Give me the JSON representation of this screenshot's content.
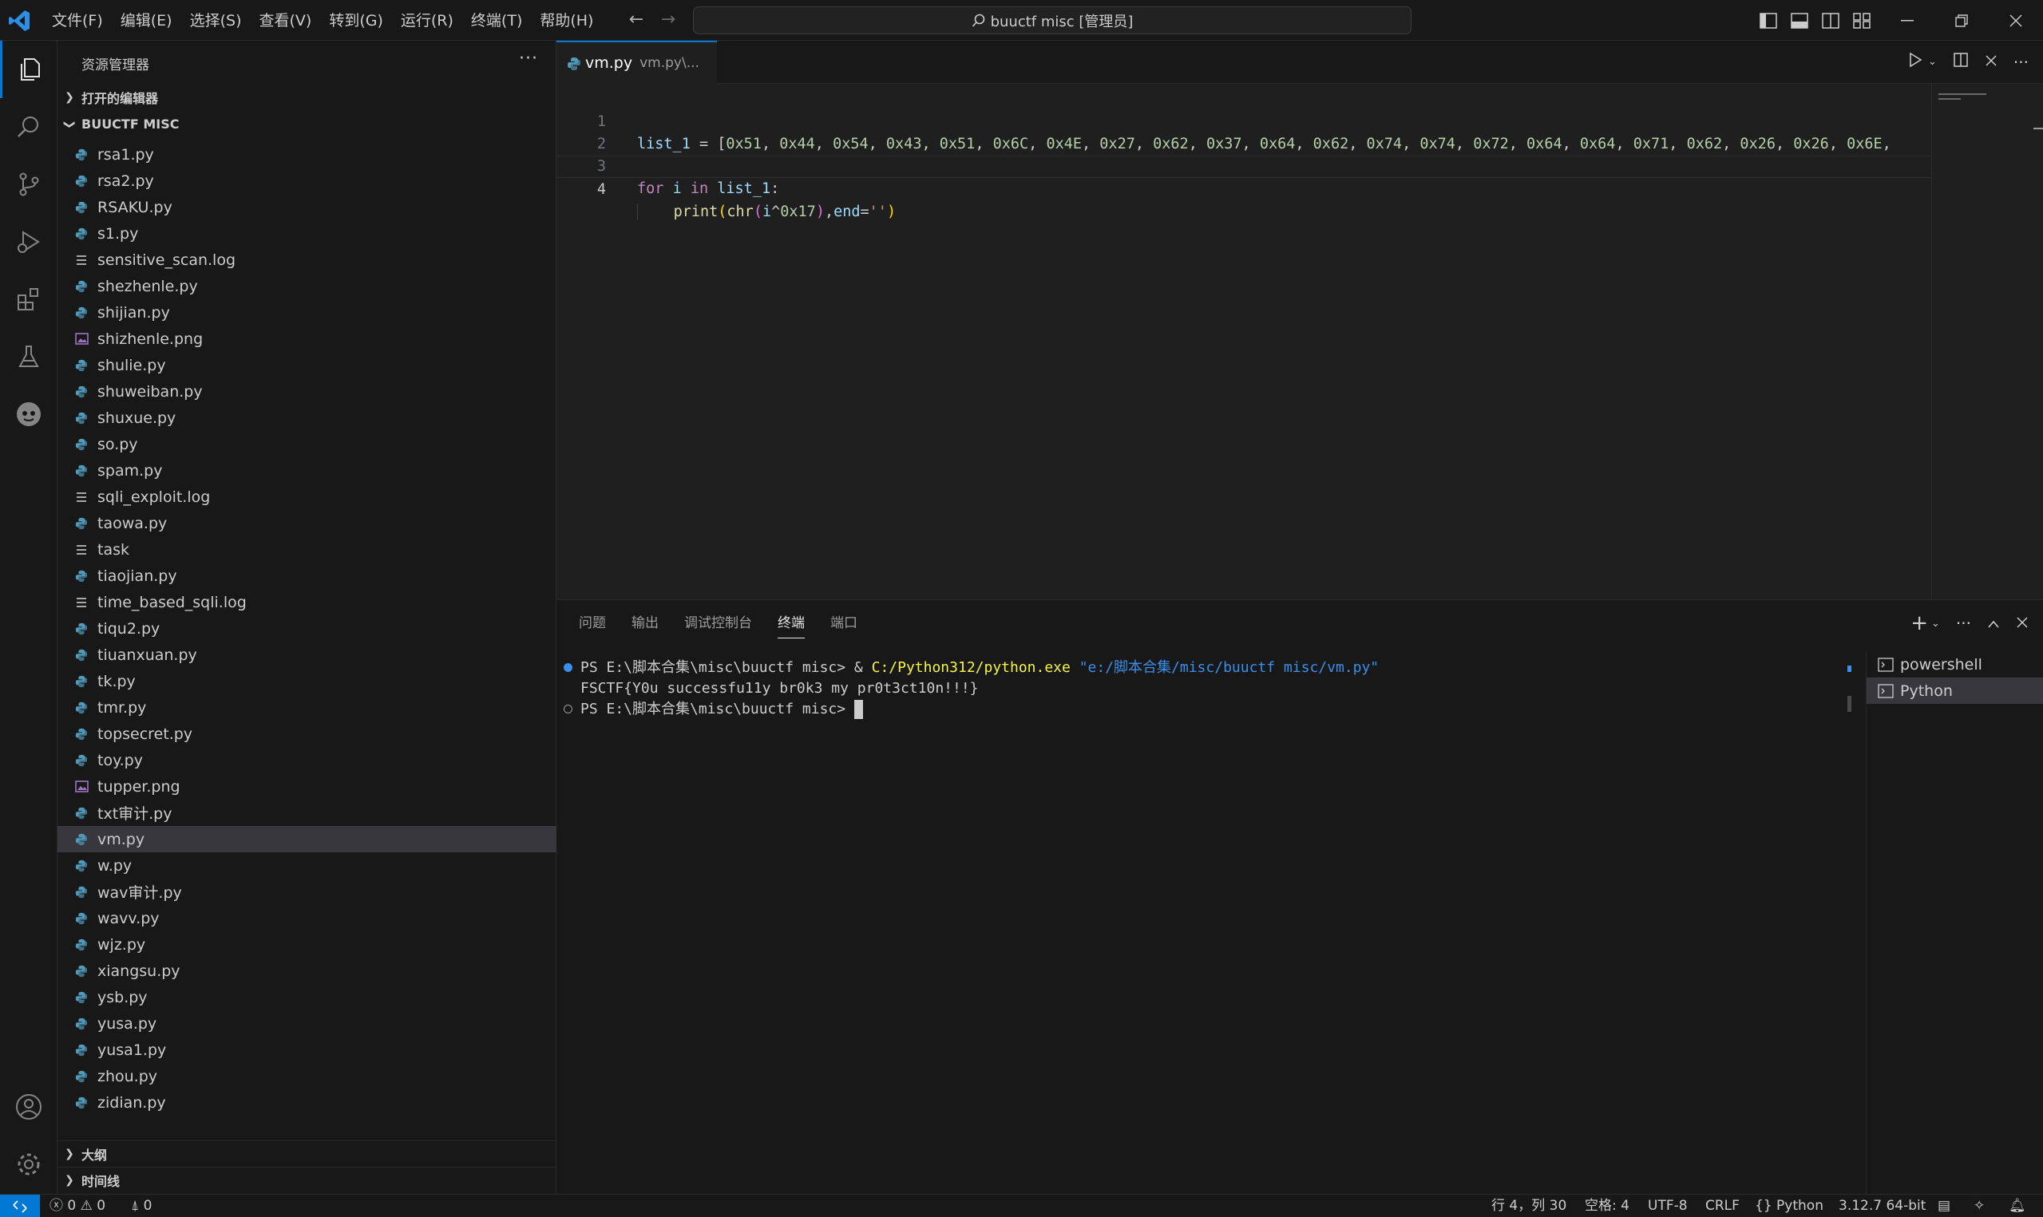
{
  "menu": [
    "文件(F)",
    "编辑(E)",
    "选择(S)",
    "查看(V)",
    "转到(G)",
    "运行(R)",
    "终端(T)",
    "帮助(H)"
  ],
  "command_center": "buuctf misc [管理员]",
  "sidebar": {
    "title": "资源管理器",
    "open_editors": "打开的编辑器",
    "folder": "BUUCTF MISC",
    "outline": "大纲",
    "timeline": "时间线",
    "files": [
      {
        "name": "rsa1.py",
        "type": "py"
      },
      {
        "name": "rsa2.py",
        "type": "py"
      },
      {
        "name": "RSAKU.py",
        "type": "py"
      },
      {
        "name": "s1.py",
        "type": "py"
      },
      {
        "name": "sensitive_scan.log",
        "type": "log"
      },
      {
        "name": "shezhenle.py",
        "type": "py"
      },
      {
        "name": "shijian.py",
        "type": "py"
      },
      {
        "name": "shizhenle.png",
        "type": "png"
      },
      {
        "name": "shulie.py",
        "type": "py"
      },
      {
        "name": "shuweiban.py",
        "type": "py"
      },
      {
        "name": "shuxue.py",
        "type": "py"
      },
      {
        "name": "so.py",
        "type": "py"
      },
      {
        "name": "spam.py",
        "type": "py"
      },
      {
        "name": "sqli_exploit.log",
        "type": "log"
      },
      {
        "name": "taowa.py",
        "type": "py"
      },
      {
        "name": "task",
        "type": "log"
      },
      {
        "name": "tiaojian.py",
        "type": "py"
      },
      {
        "name": "time_based_sqli.log",
        "type": "log"
      },
      {
        "name": "tiqu2.py",
        "type": "py"
      },
      {
        "name": "tiuanxuan.py",
        "type": "py"
      },
      {
        "name": "tk.py",
        "type": "py"
      },
      {
        "name": "tmr.py",
        "type": "py"
      },
      {
        "name": "topsecret.py",
        "type": "py"
      },
      {
        "name": "toy.py",
        "type": "py"
      },
      {
        "name": "tupper.png",
        "type": "png"
      },
      {
        "name": "txt审计.py",
        "type": "py"
      },
      {
        "name": "vm.py",
        "type": "py",
        "selected": true
      },
      {
        "name": "w.py",
        "type": "py"
      },
      {
        "name": "wav审计.py",
        "type": "py"
      },
      {
        "name": "wavv.py",
        "type": "py"
      },
      {
        "name": "wjz.py",
        "type": "py"
      },
      {
        "name": "xiangsu.py",
        "type": "py"
      },
      {
        "name": "ysb.py",
        "type": "py"
      },
      {
        "name": "yusa.py",
        "type": "py"
      },
      {
        "name": "yusa1.py",
        "type": "py"
      },
      {
        "name": "zhou.py",
        "type": "py"
      },
      {
        "name": "zidian.py",
        "type": "py"
      }
    ]
  },
  "editor": {
    "tab_name": "vm.py",
    "tab_desc": "vm.py\\...",
    "line_numbers": [
      "1",
      "2",
      "3",
      "4"
    ],
    "code": {
      "line1_var": "list_1",
      "line1_op": " = [",
      "line1_values": [
        "0x51",
        "0x44",
        "0x54",
        "0x43",
        "0x51",
        "0x6C",
        "0x4E",
        "0x27",
        "0x62",
        "0x37",
        "0x64",
        "0x62",
        "0x74",
        "0x74",
        "0x72",
        "0x64",
        "0x64",
        "0x71",
        "0x62",
        "0x26",
        "0x26",
        "0x6E"
      ],
      "line3_for": "for",
      "line3_i": "i",
      "line3_in": "in",
      "line3_list": "list_1",
      "line3_colon": ":",
      "line4_print": "print",
      "line4_chr": "chr",
      "line4_i": "i",
      "line4_xor": "^",
      "line4_hex": "0x17",
      "line4_end": "end",
      "line4_str": "''"
    }
  },
  "panel": {
    "tabs": [
      "问题",
      "输出",
      "调试控制台",
      "终端",
      "端口"
    ],
    "active_tab": "终端",
    "terminal": {
      "line1_prompt": "PS E:\\脚本合集\\misc\\buuctf misc> & ",
      "line1_exe": "C:/Python312/python.exe",
      "line1_arg": "\"e:/脚本合集/misc/buuctf misc/vm.py\"",
      "line2": "FSCTF{Y0u successfu11y br0k3 my pr0t3ct10n!!!}",
      "line3_prompt": "PS E:\\脚本合集\\misc\\buuctf misc> "
    },
    "terminals": [
      "powershell",
      "Python"
    ],
    "active_terminal": "Python"
  },
  "statusbar": {
    "errors": "0",
    "warnings": "0",
    "ports": "0",
    "position": "行 4，列 30",
    "spaces": "空格: 4",
    "encoding": "UTF-8",
    "eol": "CRLF",
    "language": "Python",
    "interpreter": "3.12.7 64-bit"
  },
  "colors": {
    "accent": "#0078d4",
    "background": "#1f1f1f",
    "sidebar_bg": "#181818",
    "python_icon": "#519aba",
    "png_icon": "#a074c4"
  }
}
